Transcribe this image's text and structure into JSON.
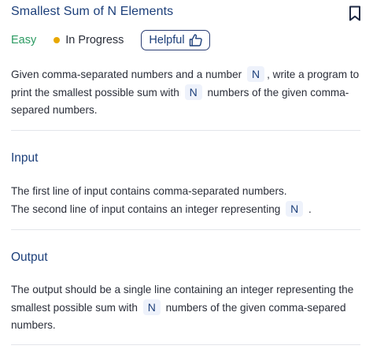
{
  "header": {
    "title": "Smallest Sum of N Elements",
    "bookmark_icon": "bookmark-icon"
  },
  "meta": {
    "difficulty": "Easy",
    "status": "In Progress",
    "helpful_label": "Helpful",
    "colors": {
      "difficulty": "#2c9b62",
      "status_dot": "#e8a800",
      "accent": "#1c3f7a"
    }
  },
  "description": {
    "part1": "Given comma-separated numbers and a number",
    "chip1": "N",
    "part2": ", write a program to print the smallest possible sum with",
    "chip2": "N",
    "part3": "numbers of the given comma-separed numbers."
  },
  "input": {
    "heading": "Input",
    "line1": "The first line of input contains comma-separated numbers.",
    "line2_part1": "The second line of input contains an integer representing",
    "line2_chip": "N",
    "line2_part2": "."
  },
  "output": {
    "heading": "Output",
    "part1": "The output should be a single line containing an integer representing the smallest possible sum with",
    "chip": "N",
    "part2": "numbers of the given comma-separed numbers."
  }
}
